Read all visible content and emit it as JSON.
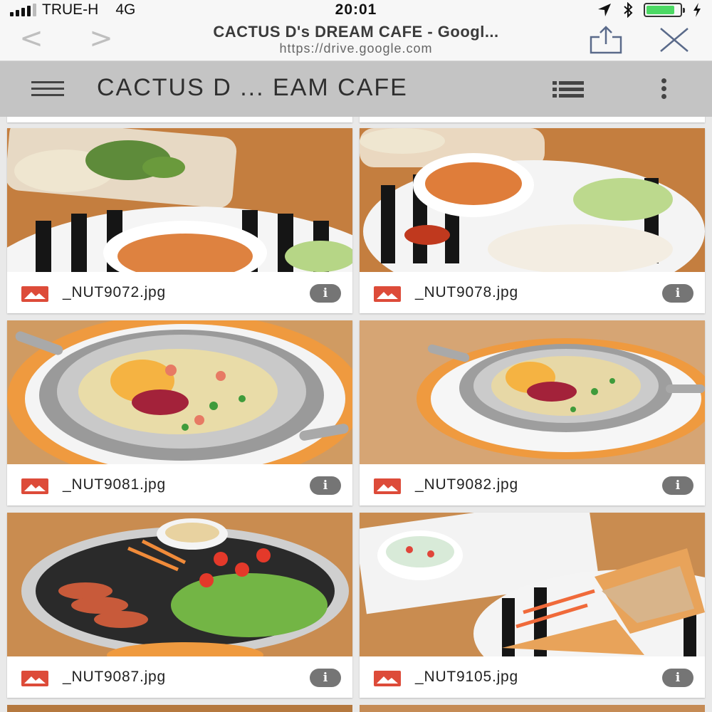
{
  "status_bar": {
    "carrier": "TRUE-H",
    "network": "4G",
    "time": "20:01",
    "battery_percent": 85
  },
  "browser": {
    "back_label": "<",
    "forward_label": ">",
    "page_title": "CACTUS D's DREAM CAFE - Googl...",
    "url": "https://drive.google.com",
    "icons": [
      "share-icon",
      "close-icon"
    ]
  },
  "app_header": {
    "title": "CACTUS D ... EAM CAFE",
    "icons": [
      "menu-icon",
      "list-view-icon",
      "more-vert-icon"
    ]
  },
  "files": [
    {
      "name": "_NUT9072.jpg",
      "info": "i"
    },
    {
      "name": "_NUT9078.jpg",
      "info": "i"
    },
    {
      "name": "_NUT9081.jpg",
      "info": "i"
    },
    {
      "name": "_NUT9082.jpg",
      "info": "i"
    },
    {
      "name": "_NUT9087.jpg",
      "info": "i"
    },
    {
      "name": "_NUT9105.jpg",
      "info": "i"
    }
  ],
  "colors": {
    "file_icon": "#dd4b39",
    "info_badge": "#757575",
    "app_header": "#c4c4c4",
    "battery_fill": "#4cd964"
  }
}
